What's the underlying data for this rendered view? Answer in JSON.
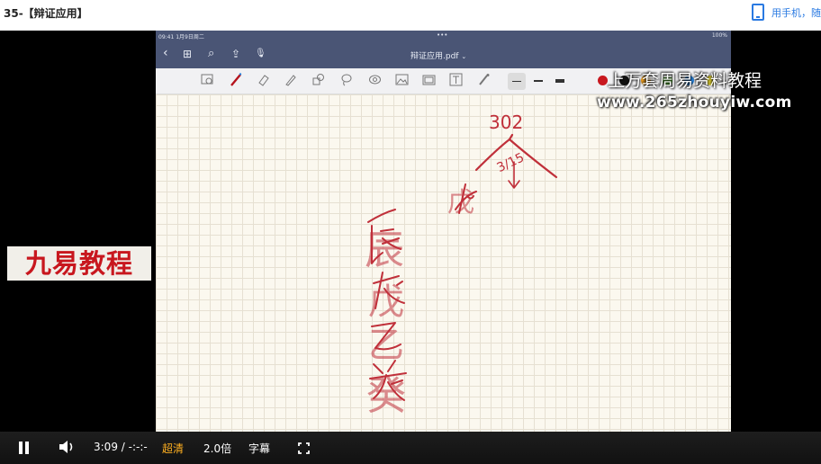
{
  "page": {
    "course_title": "35-【辩证应用】",
    "mobile_link_text": "用手机，随"
  },
  "ipad": {
    "status_time": "09:41  1月9日周二",
    "status_dots": "•••",
    "status_battery": "100%",
    "nav": {
      "back": "‹",
      "grid": "⊞",
      "search": "⌕",
      "share": "⇪",
      "mic": "🎙"
    },
    "doc_title": "辩证应用.pdf",
    "doc_caret": "⌄",
    "swatches": [
      "#c8171e",
      "#111111",
      "#f0a020",
      "#5fbf3a",
      "#2a86e0",
      "#f6e63a"
    ],
    "handwriting": [
      "302",
      "戊",
      "3/15",
      "辰",
      "戊",
      "乙",
      "癸"
    ]
  },
  "watermarks": {
    "line1": "上万套周易资料教程",
    "line2": "www.265zhouyiw.com",
    "brand": "九易教程"
  },
  "controls": {
    "time_current": "3:09",
    "time_separator": "/",
    "time_total": "-:-:-",
    "quality": "超清",
    "speed": "2.0倍",
    "subtitles": "字幕"
  }
}
